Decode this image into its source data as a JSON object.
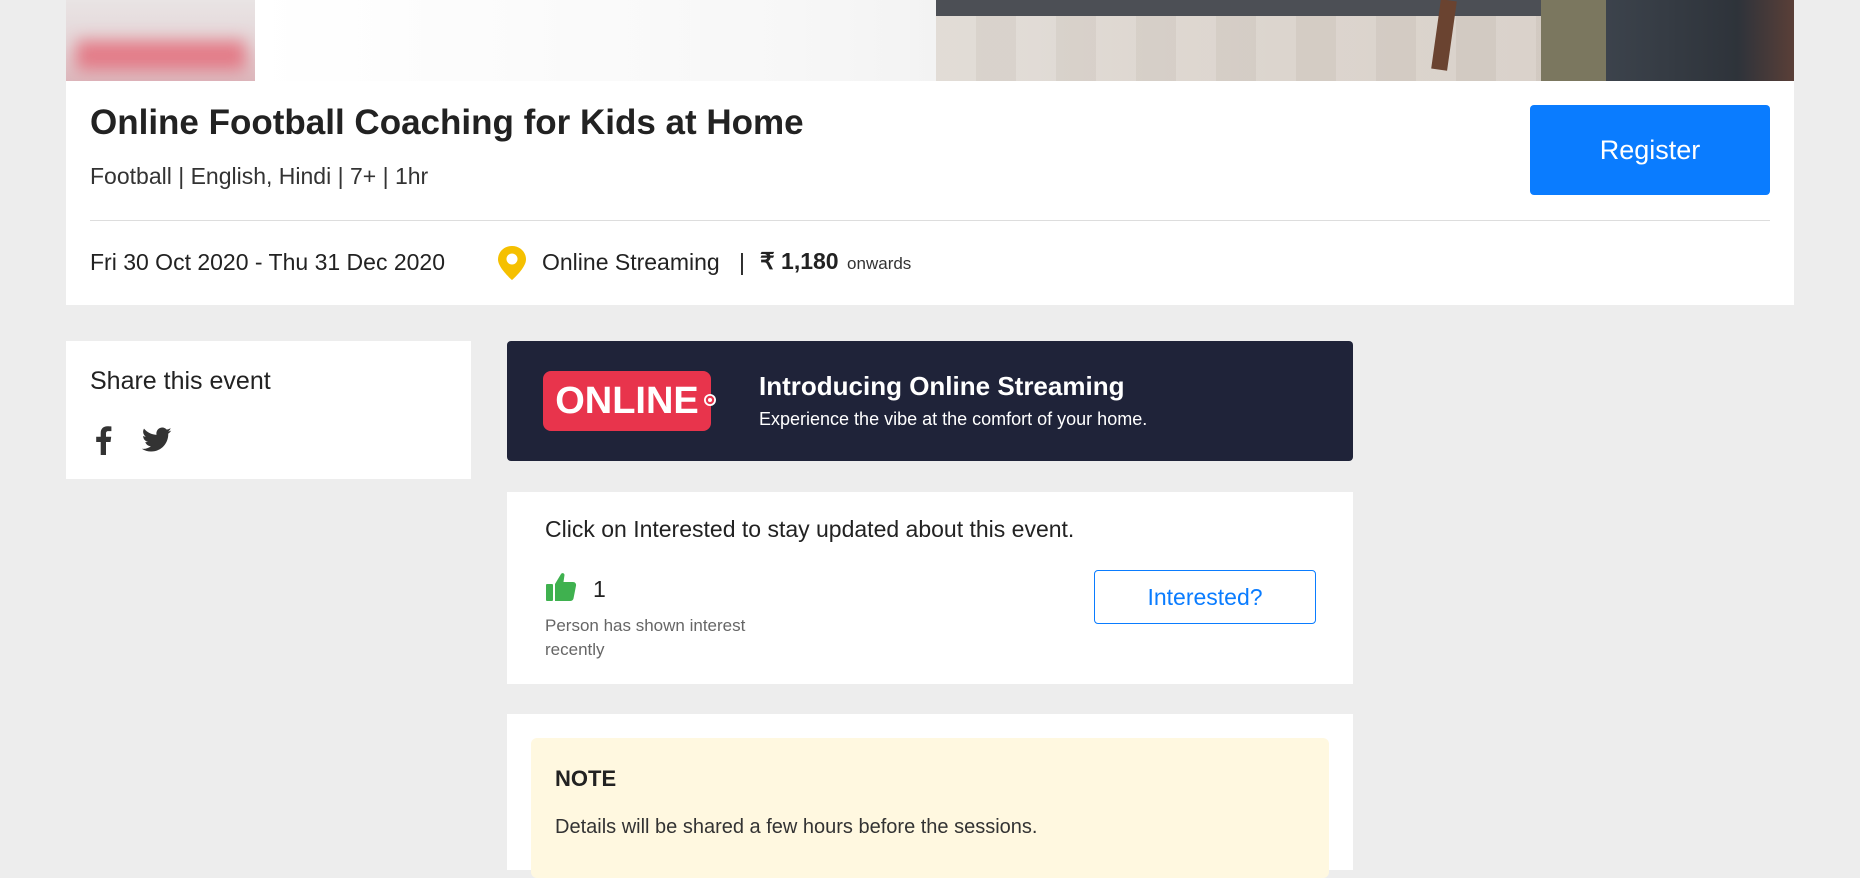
{
  "event": {
    "title": "Online Football Coaching for Kids at Home",
    "meta": "Football | English, Hindi | 7+ | 1hr",
    "date_range": "Fri 30 Oct 2020 - Thu 31 Dec 2020",
    "venue": "Online Streaming",
    "separator": "|",
    "price": "₹ 1,180",
    "price_suffix": "onwards",
    "register_label": "Register"
  },
  "share": {
    "title": "Share this event",
    "icons": [
      "facebook-icon",
      "twitter-icon"
    ]
  },
  "online_banner": {
    "badge": "ONLINE",
    "heading": "Introducing Online Streaming",
    "subheading": "Experience the vibe at the comfort of your home."
  },
  "interest": {
    "prompt": "Click on Interested to stay updated about this event.",
    "count": "1",
    "caption": "Person has shown interest recently",
    "button_label": "Interested?"
  },
  "note": {
    "title": "NOTE",
    "text": "Details will be shared a few hours before the sessions."
  },
  "colors": {
    "primary": "#0a7cff",
    "online_badge": "#e8344c",
    "banner_bg": "#1f2339",
    "pin": "#f5c000",
    "thumb": "#3fb14f",
    "note_bg": "#fff8e0",
    "page_bg": "#ededed"
  }
}
